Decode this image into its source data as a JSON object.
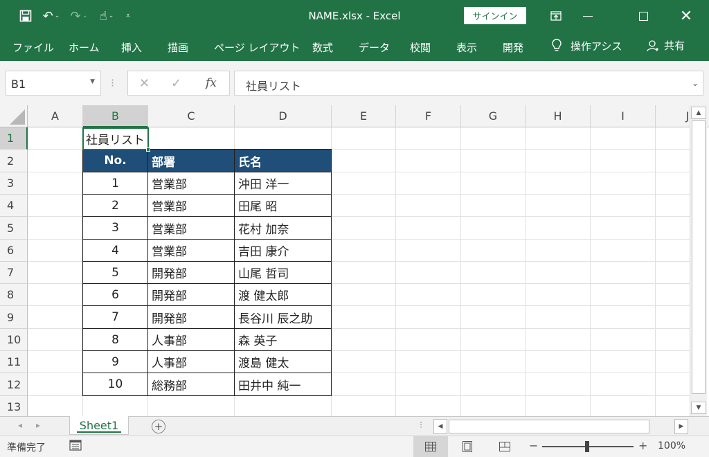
{
  "window": {
    "title": "NAME.xlsx  -  Excel",
    "signin_label": "サインイン"
  },
  "ribbon": {
    "tabs": [
      "ファイル",
      "ホーム",
      "挿入",
      "描画",
      "ページ レイアウト",
      "数式",
      "データ",
      "校閲",
      "表示",
      "開発"
    ],
    "tell_me": "操作アシス",
    "share": "共有"
  },
  "formula_bar": {
    "name_box": "B1",
    "fx_label": "fx",
    "value": "社員リスト"
  },
  "grid": {
    "columns": [
      "A",
      "B",
      "C",
      "D",
      "E",
      "F",
      "G",
      "H",
      "I",
      "J"
    ],
    "rows": [
      "1",
      "2",
      "3",
      "4",
      "5",
      "6",
      "7",
      "8",
      "9",
      "10",
      "11",
      "12",
      "13"
    ],
    "selected_column": "B",
    "selected_row": "1",
    "b1_text": "社員リスト",
    "table_headers": [
      "No.",
      "部署",
      "氏名"
    ],
    "table_rows": [
      [
        "1",
        "営業部",
        "沖田 洋一"
      ],
      [
        "2",
        "営業部",
        "田尾 昭"
      ],
      [
        "3",
        "営業部",
        "花村 加奈"
      ],
      [
        "4",
        "営業部",
        "吉田 康介"
      ],
      [
        "5",
        "開発部",
        "山尾 哲司"
      ],
      [
        "6",
        "開発部",
        "渡 健太郎"
      ],
      [
        "7",
        "開発部",
        "長谷川 辰之助"
      ],
      [
        "8",
        "人事部",
        "森 英子"
      ],
      [
        "9",
        "人事部",
        "渡島 健太"
      ],
      [
        "10",
        "総務部",
        "田井中 純一"
      ]
    ]
  },
  "sheets": {
    "active": "Sheet1"
  },
  "status": {
    "ready": "準備完了",
    "zoom": "100%"
  },
  "colors": {
    "accent": "#217346",
    "table_header": "#1f4e79"
  }
}
